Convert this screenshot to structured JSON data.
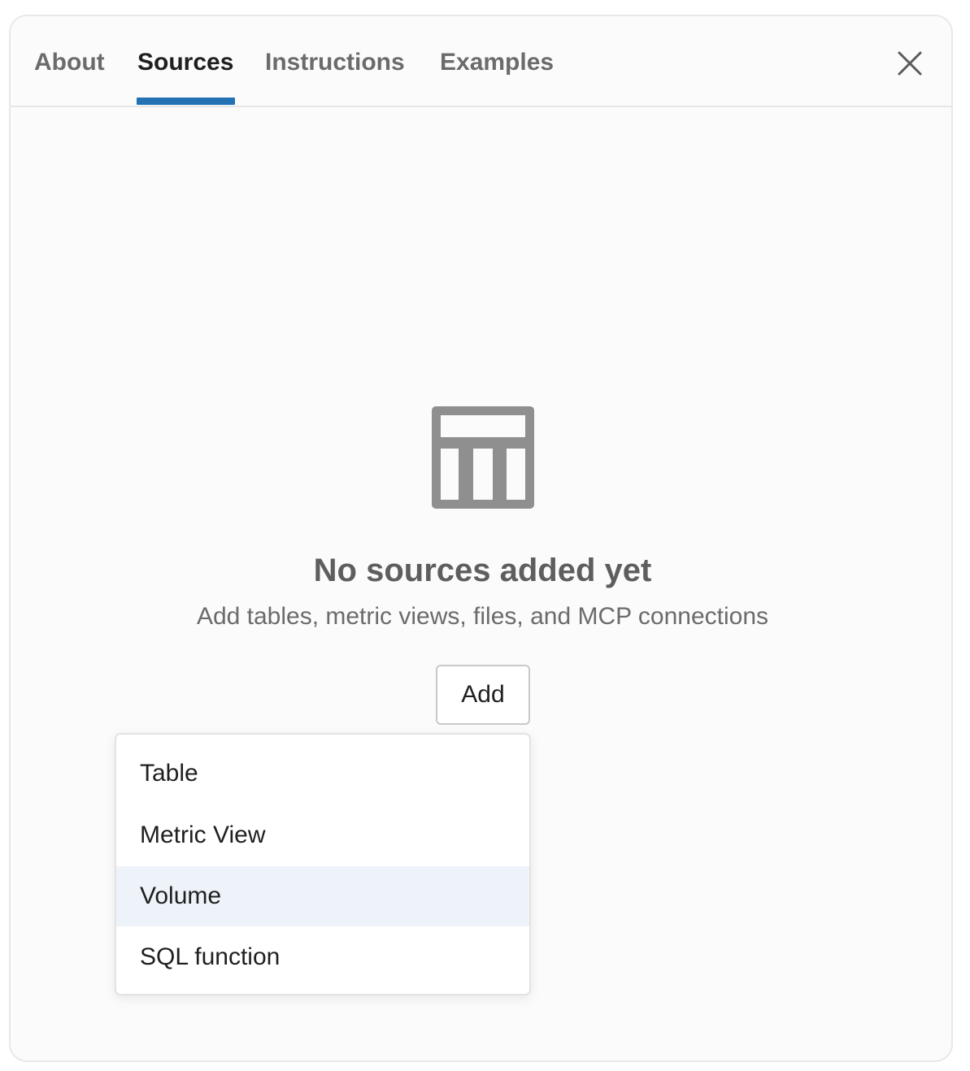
{
  "tabs": [
    {
      "label": "About",
      "active": false
    },
    {
      "label": "Sources",
      "active": true
    },
    {
      "label": "Instructions",
      "active": false
    },
    {
      "label": "Examples",
      "active": false
    }
  ],
  "colors": {
    "accent": "#2272b4",
    "active_tab_text": "#1f1f1f",
    "inactive_tab_text": "#6b6b6b",
    "highlight_row": "#eef3fa",
    "empty_icon": "#8f8f8f"
  },
  "close": {
    "icon": "close-icon"
  },
  "empty_state": {
    "icon": "table-icon",
    "title": "No sources added yet",
    "subtitle": "Add tables, metric views, files, and MCP connections"
  },
  "add_button": {
    "label": "Add"
  },
  "add_menu": {
    "items": [
      {
        "label": "Table"
      },
      {
        "label": "Metric View"
      },
      {
        "label": "Volume",
        "highlighted": true
      },
      {
        "label": "SQL function"
      }
    ]
  }
}
